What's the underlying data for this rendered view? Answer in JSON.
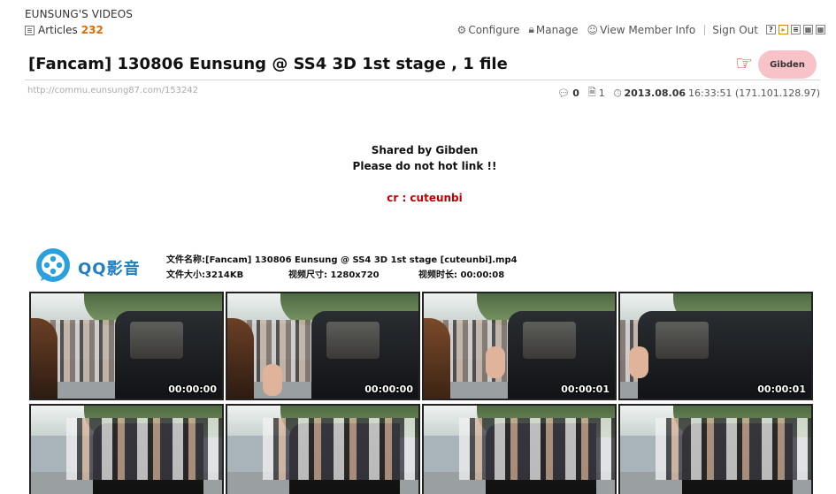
{
  "board": {
    "title": "EUNSUNG'S VIDEOS",
    "articles_label": "Articles",
    "articles_count": "232"
  },
  "toplinks": {
    "configure": "Configure",
    "manage": "Manage",
    "view_member_info": "View Member Info",
    "sign_out": "Sign Out"
  },
  "view_buttons": [
    "?",
    "▸",
    "≡",
    "▦",
    "▦"
  ],
  "post": {
    "title": "[Fancam] 130806 Eunsung @ SS4 3D 1st stage , 1 file",
    "author": "Gibden",
    "url": "http://commu.eunsung87.com/153242",
    "comments": "0",
    "files": "1",
    "date": "2013.08.06",
    "time_ip": "16:33:51 (171.101.128.97)"
  },
  "body": {
    "shared_by": "Shared by Gibden",
    "no_hotlink": "Please do not hot link !!",
    "credit": "cr : cuteunbi"
  },
  "player": {
    "logo_text": "QQ影音",
    "file_name_line": "文件名称:[Fancam] 130806 Eunsung @ SS4 3D 1st stage [cuteunbi].mp4",
    "file_size": "文件大小:3214KB",
    "resolution": "视频尺寸: 1280x720",
    "duration": "视频时长: 00:00:08"
  },
  "thumbnails": {
    "row1": [
      "00:00:00",
      "00:00:00",
      "00:00:01",
      "00:00:01"
    ]
  },
  "colors": {
    "accent_orange": "#e06a00",
    "credit_red": "#c00000",
    "qq_blue": "#1f7fc3",
    "badge_pink": "#f7c2c8"
  }
}
